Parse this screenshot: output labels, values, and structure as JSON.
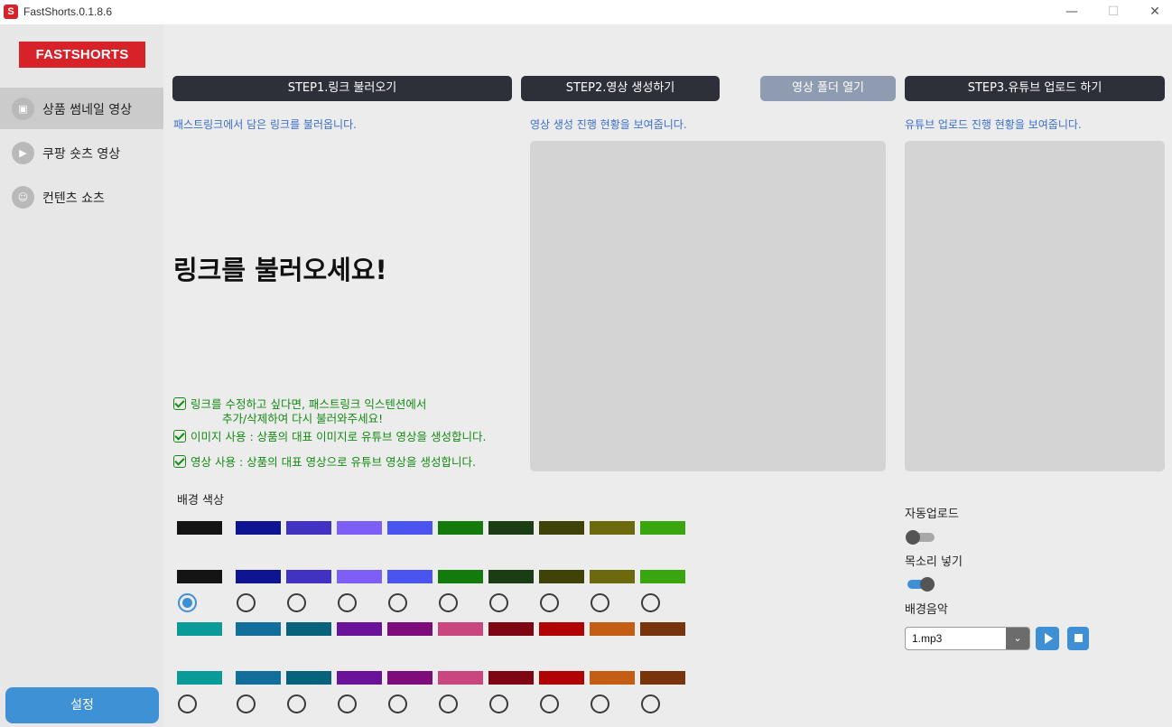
{
  "window": {
    "title": "FastShorts.0.1.8.6",
    "app_icon_glyph": "S",
    "min_icon": "—",
    "max_icon": "☐",
    "close_icon": "✕"
  },
  "sidebar": {
    "logo": "FASTSHORTS",
    "items": [
      {
        "label": "상품 썸네일 영상",
        "icon": "bag-icon",
        "glyph": "▣",
        "active": true
      },
      {
        "label": "쿠팡 숏츠 영상",
        "icon": "play-icon",
        "glyph": "▶",
        "active": false
      },
      {
        "label": "컨텐츠 쇼츠",
        "icon": "smile-icon",
        "glyph": "☺",
        "active": false
      }
    ],
    "settings_label": "설정"
  },
  "steps": {
    "step1": {
      "label": "STEP1.링크 불러오기",
      "desc": "패스트링크에서 담은 링크를 불러옵니다."
    },
    "step2": {
      "label": "STEP2.영상 생성하기",
      "desc": "영상 생성 진행 현황을 보여줍니다."
    },
    "open_folder": {
      "label": "영상 폴더 열기"
    },
    "step3": {
      "label": "STEP3.유튜브 업로드 하기",
      "desc": "유튜브 업로드 진행 현황을 보여줍니다."
    }
  },
  "main": {
    "big_title": "링크를 불러오세요!",
    "notes": {
      "line1": "링크를 수정하고 싶다면, 패스트링크 익스텐션에서",
      "line1_sub": "추가/삭제하여 다시 불러와주세요!",
      "line2": "이미지 사용 : 상품의 대표 이미지로 유튜브 영상을 생성합니다.",
      "line3": "영상 사용 : 상품의 대표 영상으로 유튜브 영상을 생성합니다."
    },
    "bg_color_label": "배경 색상"
  },
  "palette": {
    "row1_colors": [
      "#141414",
      "#0f1592",
      "#4232c2",
      "#7d5ef7",
      "#4a54ef",
      "#137a0c",
      "#1a3d14",
      "#3f4308",
      "#6d6a0d",
      "#3aa60f"
    ],
    "row2_colors": [
      "#0a9b99",
      "#126f9c",
      "#06637b",
      "#6a129a",
      "#7e0c7a",
      "#c9467f",
      "#7e0512",
      "#b00404",
      "#c35e14",
      "#78340b"
    ],
    "selected_index": 0
  },
  "options": {
    "auto_upload_label": "자동업로드",
    "auto_upload_on": false,
    "voice_label": "목소리 넣기",
    "voice_on": true,
    "bgm_label": "배경음악",
    "bgm_value": "1.mp3",
    "bgm_arrow": "⌄"
  }
}
